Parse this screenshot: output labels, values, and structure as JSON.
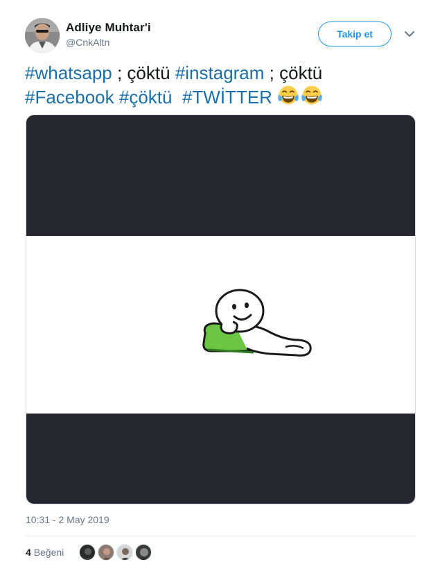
{
  "author": {
    "name": "Adliye Muhtar'i",
    "handle": "@CnkAltn",
    "avatar": "profile-photo"
  },
  "follow_button": {
    "label": "Takip et"
  },
  "menu": {
    "icon": "chevron-down-icon"
  },
  "tweet": {
    "line1": [
      {
        "text": "#whatsapp",
        "hashtag": true
      },
      {
        "text": " ; çöktü ",
        "hashtag": false
      },
      {
        "text": "#instagram",
        "hashtag": true
      },
      {
        "text": " ; çöktü",
        "hashtag": false
      }
    ],
    "line2": [
      {
        "text": "#Facebook",
        "hashtag": true
      },
      {
        "text": " ",
        "hashtag": false
      },
      {
        "text": "#çöktü",
        "hashtag": true
      },
      {
        "text": "  ",
        "hashtag": false
      },
      {
        "text": "#TWİTTER",
        "hashtag": true
      },
      {
        "text": " ",
        "hashtag": false
      }
    ],
    "emojis": [
      "face-with-tears-of-joy",
      "face-with-tears-of-joy"
    ]
  },
  "media": {
    "description_icon": "lounging-character-illustration"
  },
  "timestamp": "10:31 - 2 May 2019",
  "likes": {
    "count": "4",
    "label": "Beğeni"
  },
  "likers": [
    "avatar",
    "avatar",
    "avatar",
    "avatar"
  ],
  "colors": {
    "accent": "#1b95e0",
    "hashtag": "#1b6fa8",
    "muted": "#657786",
    "media_dark": "#25262e"
  }
}
